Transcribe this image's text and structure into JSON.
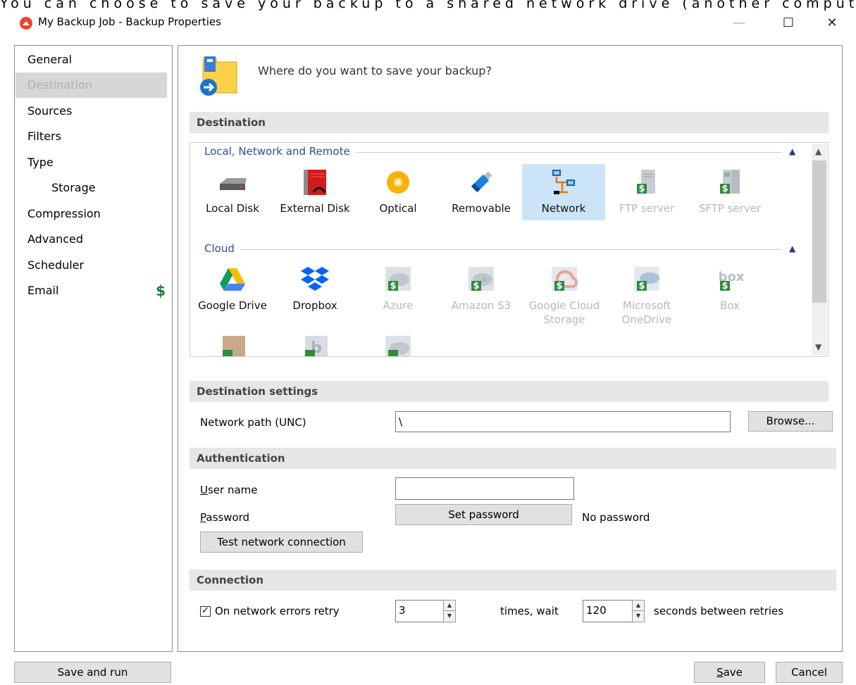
{
  "top_caption": "You can choose to save your backup to a shared network drive (another computer or NAS).",
  "window": {
    "title": "My Backup Job - Backup Properties",
    "minimize": "—",
    "maximize": "☐",
    "close": "✕"
  },
  "sidebar": {
    "items": [
      {
        "label": "General"
      },
      {
        "label": "Destination"
      },
      {
        "label": "Sources"
      },
      {
        "label": "Filters"
      },
      {
        "label": "Type"
      },
      {
        "label": "Storage"
      },
      {
        "label": "Compression"
      },
      {
        "label": "Advanced"
      },
      {
        "label": "Scheduler"
      },
      {
        "label": "Email",
        "badge": "$"
      }
    ],
    "active": "Destination"
  },
  "header": {
    "question": "Where do you want to save your backup?"
  },
  "destination": {
    "section_title": "Destination",
    "groups": [
      {
        "label": "Local, Network and Remote",
        "tiles": [
          {
            "label": "Local Disk",
            "icon": "local-disk-icon"
          },
          {
            "label": "External Disk",
            "icon": "external-disk-icon"
          },
          {
            "label": "Optical",
            "icon": "optical-disc-icon"
          },
          {
            "label": "Removable",
            "icon": "usb-stick-icon"
          },
          {
            "label": "Network",
            "icon": "network-icon",
            "selected": true
          },
          {
            "label": "FTP server",
            "icon": "ftp-server-icon",
            "disabled": true
          },
          {
            "label": "SFTP server",
            "icon": "sftp-server-icon",
            "disabled": true
          }
        ]
      },
      {
        "label": "Cloud",
        "tiles": [
          {
            "label": "Google Drive",
            "icon": "google-drive-icon"
          },
          {
            "label": "Dropbox",
            "icon": "dropbox-icon"
          },
          {
            "label": "Azure",
            "icon": "azure-icon",
            "disabled": true
          },
          {
            "label": "Amazon S3",
            "icon": "amazon-s3-icon",
            "disabled": true
          },
          {
            "label": "Google Cloud Storage",
            "line1": "Google Cloud",
            "line2": "Storage",
            "icon": "google-cloud-icon",
            "disabled": true
          },
          {
            "label": "Microsoft OneDrive",
            "line1": "Microsoft",
            "line2": "OneDrive",
            "icon": "onedrive-icon",
            "disabled": true
          },
          {
            "label": "Box",
            "icon": "box-icon",
            "disabled": true
          }
        ]
      }
    ]
  },
  "destination_settings": {
    "section_title": "Destination settings",
    "network_path_label": "Network path (UNC)",
    "network_path_value": "\\",
    "browse_label": "Browse..."
  },
  "authentication": {
    "section_title": "Authentication",
    "user_name_label_u": "U",
    "user_name_label_rest": "ser name",
    "user_name_value": "",
    "password_label_u": "P",
    "password_label_rest": "assword",
    "set_password_label": "Set password",
    "password_status": "No password",
    "test_connection_label": "Test network connection"
  },
  "connection": {
    "section_title": "Connection",
    "retry_checked": true,
    "retry_label": "On network errors retry",
    "retry_count": "3",
    "times_wait_label": "times, wait",
    "wait_seconds": "120",
    "seconds_label": "seconds between retries"
  },
  "footer": {
    "save_and_run_label": "Save and run",
    "save_label_u": "S",
    "save_label_rest": "ave",
    "cancel_label": "Cancel"
  },
  "colors": {
    "accent_selected": "#cce4f7",
    "group_label": "#2d4f9a",
    "dollar_green": "#1c7f32",
    "logo_red": "#e8462c"
  }
}
